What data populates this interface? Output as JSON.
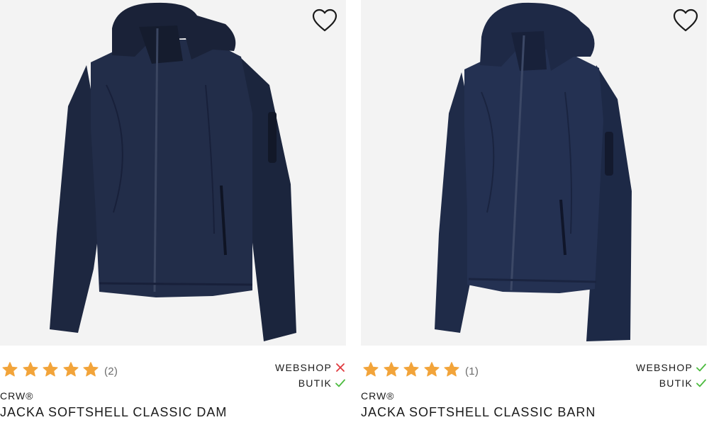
{
  "colors": {
    "star": "#f2a43a",
    "check": "#4cbb3f",
    "cross": "#e0393e",
    "jacket": "#1f2a44",
    "image_bg": "#f3f3f3"
  },
  "products": [
    {
      "wishlist_icon": "heart-outline-icon",
      "rating": {
        "stars": 5,
        "count": "(2)"
      },
      "availability": [
        {
          "label": "WEBSHOP",
          "status": "unavailable",
          "icon": "cross-icon"
        },
        {
          "label": "BUTIK",
          "status": "available",
          "icon": "check-icon"
        }
      ],
      "brand": "CRW®",
      "name": "JACKA SOFTSHELL CLASSIC DAM"
    },
    {
      "wishlist_icon": "heart-outline-icon",
      "rating": {
        "stars": 5,
        "count": "(1)"
      },
      "availability": [
        {
          "label": "WEBSHOP",
          "status": "available",
          "icon": "check-icon"
        },
        {
          "label": "BUTIK",
          "status": "available",
          "icon": "check-icon"
        }
      ],
      "brand": "CRW®",
      "name": "JACKA SOFTSHELL CLASSIC BARN"
    }
  ]
}
